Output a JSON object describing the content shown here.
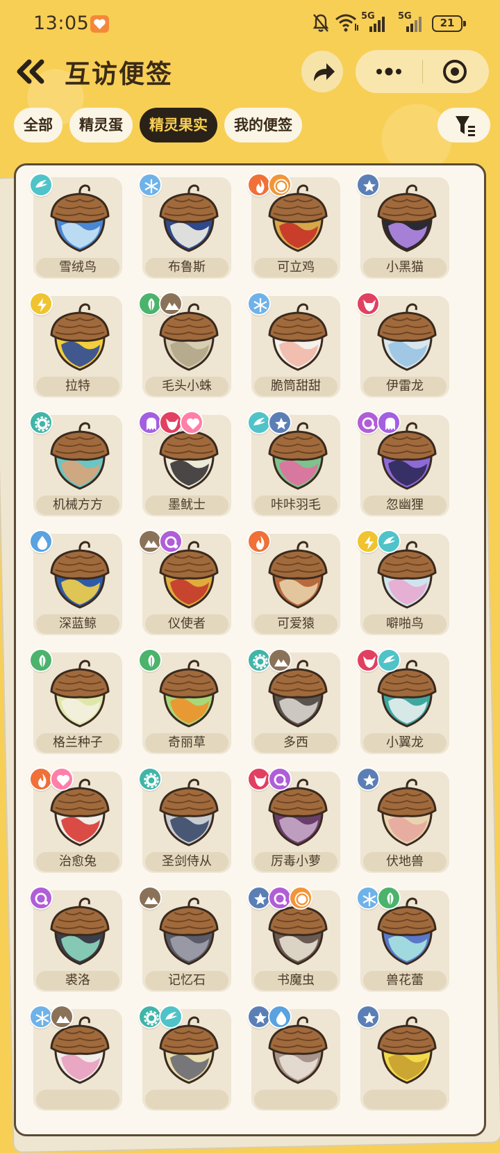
{
  "status": {
    "time": "13:05",
    "battery": "21",
    "network1": "5G",
    "network2": "5G"
  },
  "header": {
    "title": "互访便签"
  },
  "tabs": [
    {
      "label": "全部",
      "active": false
    },
    {
      "label": "精灵蛋",
      "active": false
    },
    {
      "label": "精灵果实",
      "active": true
    },
    {
      "label": "我的便签",
      "active": false
    }
  ],
  "colors": {
    "water": "#5aa2e0",
    "ice": "#6fb2e8",
    "fire": "#f07038",
    "cute": "#ff7fa8",
    "normal": "#5b7fb5",
    "electric": "#f0c430",
    "grass": "#4bb36b",
    "earth": "#8a7258",
    "wing": "#4fc3c8",
    "mech": "#40b5a8",
    "ghost": "#a45fe0",
    "demon": "#e24060",
    "light": "#f0963a",
    "poison": "#b05ed8",
    "dragon": "#e24060"
  },
  "fruits": [
    {
      "name": "雪绒鸟",
      "badges": [
        "wing"
      ],
      "body": "#4a86d4",
      "accent": "#c6e4f5"
    },
    {
      "name": "布鲁斯",
      "badges": [
        "ice"
      ],
      "body": "#2e4a8c",
      "accent": "#f2efe6"
    },
    {
      "name": "可立鸡",
      "badges": [
        "fire",
        "light"
      ],
      "body": "#d7a84a",
      "accent": "#c73228"
    },
    {
      "name": "小黑猫",
      "badges": [
        "normal"
      ],
      "body": "#2a2a32",
      "accent": "#b28ae8"
    },
    {
      "name": "拉特",
      "badges": [
        "electric"
      ],
      "body": "#f2cf3c",
      "accent": "#2e4a98"
    },
    {
      "name": "毛头小蛛",
      "badges": [
        "grass",
        "earth"
      ],
      "body": "#d8ceb4",
      "accent": "#b3a888"
    },
    {
      "name": "脆筒甜甜",
      "badges": [
        "ice"
      ],
      "body": "#f4f0ea",
      "accent": "#f2b8a8"
    },
    {
      "name": "伊雷龙",
      "badges": [
        "dragon"
      ],
      "body": "#d8e6ee",
      "accent": "#9ac4e2"
    },
    {
      "name": "机械方方",
      "badges": [
        "mech"
      ],
      "body": "#6ac6c4",
      "accent": "#d8a47a"
    },
    {
      "name": "墨鱿士",
      "badges": [
        "ghost",
        "demon",
        "cute"
      ],
      "body": "#ecead8",
      "accent": "#3a3436"
    },
    {
      "name": "咔咔羽毛",
      "badges": [
        "wing",
        "normal"
      ],
      "body": "#7fc28e",
      "accent": "#e270a0"
    },
    {
      "name": "忽幽狸",
      "badges": [
        "poison",
        "ghost"
      ],
      "body": "#8e6ad8",
      "accent": "#2e2a5a"
    },
    {
      "name": "深蓝鲸",
      "badges": [
        "water"
      ],
      "body": "#2e5aa8",
      "accent": "#f2d04a"
    },
    {
      "name": "仪使者",
      "badges": [
        "earth",
        "poison"
      ],
      "body": "#e0ac3c",
      "accent": "#c43a2c"
    },
    {
      "name": "可爱猿",
      "badges": [
        "fire"
      ],
      "body": "#b86a3c",
      "accent": "#e8d0a8"
    },
    {
      "name": "噼啪鸟",
      "badges": [
        "electric",
        "wing"
      ],
      "body": "#cfe4ee",
      "accent": "#e8a8d0"
    },
    {
      "name": "格兰种子",
      "badges": [
        "grass"
      ],
      "body": "#dfe7a8",
      "accent": "#f4f0e0"
    },
    {
      "name": "奇丽草",
      "badges": [
        "grass"
      ],
      "body": "#a8d878",
      "accent": "#f0922c"
    },
    {
      "name": "多西",
      "badges": [
        "mech",
        "earth"
      ],
      "body": "#5a5450",
      "accent": "#d8d4cc"
    },
    {
      "name": "小翼龙",
      "badges": [
        "dragon",
        "wing"
      ],
      "body": "#3ea8a0",
      "accent": "#e8f0ee"
    },
    {
      "name": "治愈兔",
      "badges": [
        "fire",
        "cute"
      ],
      "body": "#f0ece6",
      "accent": "#d83a34"
    },
    {
      "name": "圣剑侍从",
      "badges": [
        "mech"
      ],
      "body": "#c8ccd0",
      "accent": "#3a4a68"
    },
    {
      "name": "厉毒小萝",
      "badges": [
        "demon",
        "poison"
      ],
      "body": "#6a3e6a",
      "accent": "#c8a8c8"
    },
    {
      "name": "伏地兽",
      "badges": [
        "normal"
      ],
      "body": "#e8d4b0",
      "accent": "#e8a8a0"
    },
    {
      "name": "裘洛",
      "badges": [
        "poison"
      ],
      "body": "#3a3e4a",
      "accent": "#8ed8c0"
    },
    {
      "name": "记忆石",
      "badges": [
        "earth"
      ],
      "body": "#5a5a68",
      "accent": "#a0a0ac"
    },
    {
      "name": "书魔虫",
      "badges": [
        "normal",
        "poison",
        "light"
      ],
      "body": "#6a5a52",
      "accent": "#e8e0d0"
    },
    {
      "name": "兽花蕾",
      "badges": [
        "ice",
        "grass"
      ],
      "body": "#5a78c8",
      "accent": "#a8e4e0"
    },
    {
      "name": "",
      "badges": [
        "ice",
        "earth"
      ],
      "body": "#f0ece8",
      "accent": "#e8a0c0"
    },
    {
      "name": "",
      "badges": [
        "mech",
        "wing"
      ],
      "body": "#e8dcb0",
      "accent": "#6a6a72"
    },
    {
      "name": "",
      "badges": [
        "normal",
        "water"
      ],
      "body": "#a8948a",
      "accent": "#eae0d6"
    },
    {
      "name": "",
      "badges": [
        "normal"
      ],
      "body": "#f2da4a",
      "accent": "#c8a030"
    }
  ]
}
